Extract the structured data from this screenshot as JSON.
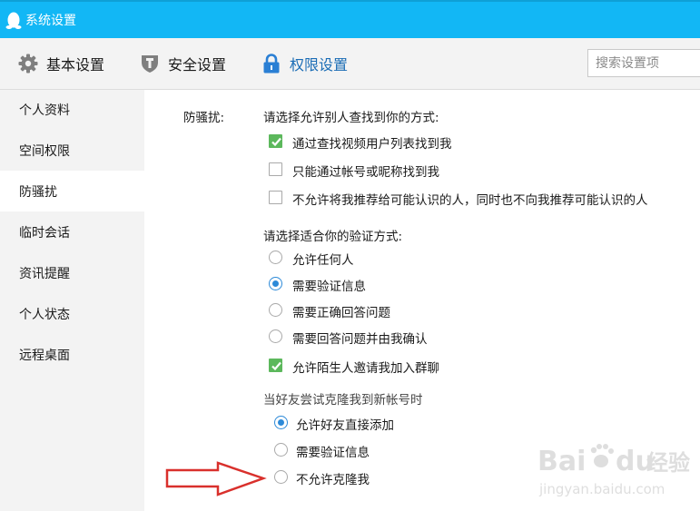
{
  "window": {
    "title": "系统设置"
  },
  "tabs": [
    {
      "label": "基本设置",
      "icon": "gear-icon",
      "active": false
    },
    {
      "label": "安全设置",
      "icon": "shield-icon",
      "active": false
    },
    {
      "label": "权限设置",
      "icon": "lock-icon",
      "active": true
    }
  ],
  "search": {
    "placeholder": "搜索设置项"
  },
  "sidebar": {
    "items": [
      {
        "label": "个人资料",
        "active": false
      },
      {
        "label": "空间权限",
        "active": false
      },
      {
        "label": "防骚扰",
        "active": true
      },
      {
        "label": "临时会话",
        "active": false
      },
      {
        "label": "资讯提醒",
        "active": false
      },
      {
        "label": "个人状态",
        "active": false
      },
      {
        "label": "远程桌面",
        "active": false
      }
    ]
  },
  "main": {
    "section_label": "防骚扰:",
    "find_prompt": "请选择允许别人查找到你的方式:",
    "find_options": [
      {
        "label": "通过查找视频用户列表找到我",
        "checked": true
      },
      {
        "label": "只能通过帐号或昵称找到我",
        "checked": false
      },
      {
        "label": "不允许将我推荐给可能认识的人，同时也不向我推荐可能认识的人",
        "checked": false
      }
    ],
    "verify_prompt": "请选择适合你的验证方式:",
    "verify_options": [
      {
        "label": "允许任何人",
        "selected": false
      },
      {
        "label": "需要验证信息",
        "selected": true
      },
      {
        "label": "需要正确回答问题",
        "selected": false
      },
      {
        "label": "需要回答问题并由我确认",
        "selected": false
      }
    ],
    "group_invite": {
      "label": "允许陌生人邀请我加入群聊",
      "checked": true
    },
    "clone_prompt": "当好友尝试克隆我到新帐号时",
    "clone_options": [
      {
        "label": "允许好友直接添加",
        "selected": true
      },
      {
        "label": "需要验证信息",
        "selected": false
      },
      {
        "label": "不允许克隆我",
        "selected": false
      }
    ]
  },
  "watermark": {
    "brand": "Bai",
    "brand2": "du",
    "cn": "经验",
    "url": "jingyan.baidu.com"
  },
  "colors": {
    "titlebar": "#12b7f5",
    "accent": "#1a6cb5",
    "check_green": "#5cb85c",
    "radio_blue": "#2d8ad8",
    "arrow_red": "#d9302c"
  }
}
